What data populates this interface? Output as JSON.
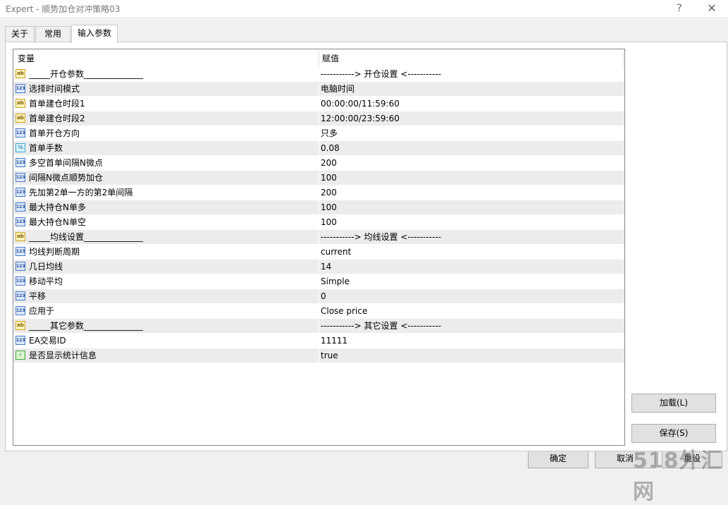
{
  "window": {
    "title": "Expert - 顺势加仓对冲策略03",
    "help_label": "?",
    "close_label": "✕"
  },
  "tabs": [
    {
      "label": "关于",
      "active": false
    },
    {
      "label": "常用",
      "active": false
    },
    {
      "label": "输入参数",
      "active": true
    }
  ],
  "grid": {
    "columns": [
      "变量",
      "赋值"
    ],
    "rows": [
      {
        "icon": "ab",
        "name": "_____开仓参数______________",
        "value": "-----------> 开仓设置 <-----------"
      },
      {
        "icon": "123",
        "name": "选择时间模式",
        "value": "电脑时间"
      },
      {
        "icon": "ab",
        "name": "首单建仓时段1",
        "value": "00:00:00/11:59:60"
      },
      {
        "icon": "ab",
        "name": "首单建仓时段2",
        "value": "12:00:00/23:59:60"
      },
      {
        "icon": "123",
        "name": "首单开仓方向",
        "value": "只多"
      },
      {
        "icon": "frac",
        "name": "首单手数",
        "value": "0.08"
      },
      {
        "icon": "123",
        "name": "多空首单间隔N微点",
        "value": "200"
      },
      {
        "icon": "123",
        "name": "间隔N微点顺势加仓",
        "value": "100"
      },
      {
        "icon": "123",
        "name": "先加第2单一方的第2单间隔",
        "value": "200"
      },
      {
        "icon": "123",
        "name": "最大持仓N单多",
        "value": "100"
      },
      {
        "icon": "123",
        "name": "最大持仓N单空",
        "value": "100"
      },
      {
        "icon": "ab",
        "name": "_____均线设置______________",
        "value": "-----------> 均线设置 <-----------"
      },
      {
        "icon": "123",
        "name": "均线判断周期",
        "value": "current"
      },
      {
        "icon": "123",
        "name": "几日均线",
        "value": "14"
      },
      {
        "icon": "123",
        "name": "移动平均",
        "value": "Simple"
      },
      {
        "icon": "123",
        "name": "平移",
        "value": "0"
      },
      {
        "icon": "123",
        "name": "应用于",
        "value": "Close price"
      },
      {
        "icon": "ab",
        "name": "_____其它参数______________",
        "value": "-----------> 其它设置 <-----------"
      },
      {
        "icon": "123",
        "name": "EA交易ID",
        "value": "11111"
      },
      {
        "icon": "bool",
        "name": "是否显示统计信息",
        "value": "true"
      }
    ]
  },
  "icon_glyphs": {
    "ab": "ab",
    "123": "123",
    "frac": "½",
    "bool": "✓"
  },
  "buttons": {
    "load": "加载(L)",
    "save": "保存(S)",
    "ok": "确定",
    "cancel": "取消",
    "reset": "重设"
  },
  "watermark": "518外汇网"
}
